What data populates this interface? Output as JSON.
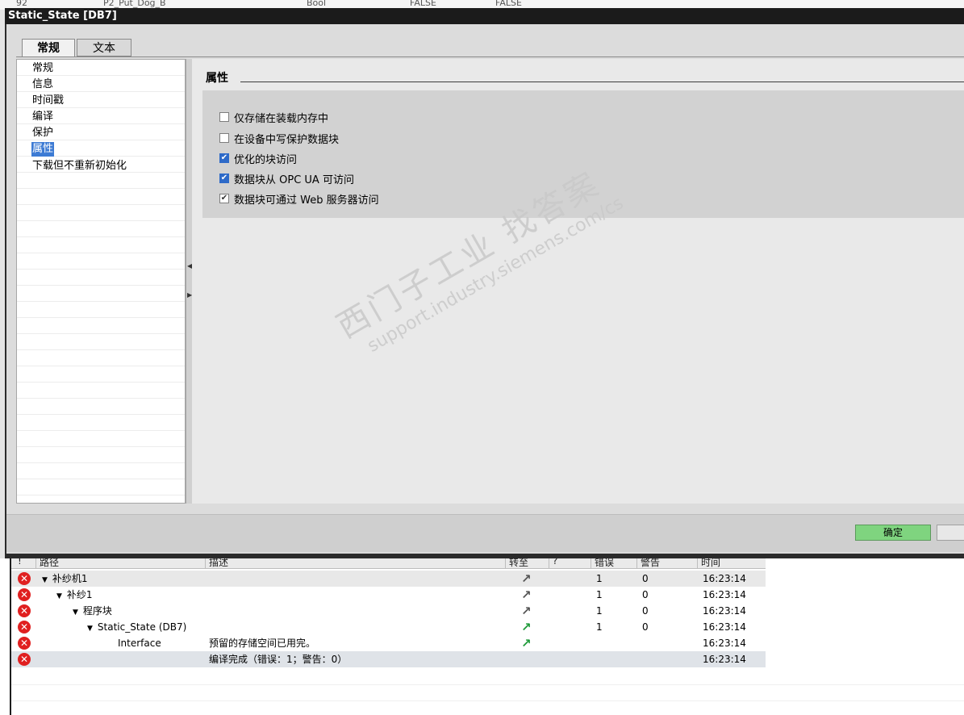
{
  "background": {
    "row_fragments": [
      "92",
      "P2_Put_Dog_B",
      "Bool",
      "FALSE",
      "FALSE"
    ]
  },
  "dialog": {
    "title": "Static_State [DB7]",
    "tabs": [
      {
        "label": "常规",
        "active": true
      },
      {
        "label": "文本",
        "active": false
      }
    ],
    "nav_items": [
      {
        "label": "常规",
        "selected": false
      },
      {
        "label": "信息",
        "selected": false
      },
      {
        "label": "时间戳",
        "selected": false
      },
      {
        "label": "编译",
        "selected": false
      },
      {
        "label": "保护",
        "selected": false
      },
      {
        "label": "属性",
        "selected": true
      },
      {
        "label": "下载但不重新初始化",
        "selected": false
      }
    ],
    "section_title": "属性",
    "properties": [
      {
        "label": "仅存储在装载内存中",
        "checked": false
      },
      {
        "label": "在设备中写保护数据块",
        "checked": false
      },
      {
        "label": "优化的块访问",
        "checked": true
      },
      {
        "label": "数据块从 OPC UA 可访问",
        "checked": true
      },
      {
        "label": "数据块可通过 Web 服务器访问",
        "checked": true
      }
    ],
    "watermark_line1": "西门子工业  找答案",
    "watermark_line2": "support.industry.siemens.com/cs",
    "ok_label": "确定",
    "colors": {
      "selection": "#3d7bd4",
      "ok_button": "#7fd47f",
      "checkbox_checked": "#2e6ac8"
    }
  },
  "results_table": {
    "headers": {
      "bang": "!",
      "path": "路径",
      "description": "描述",
      "goto": "转至",
      "q": "?",
      "errors": "错误",
      "warnings": "警告",
      "time": "时间"
    },
    "rows": [
      {
        "path": "补纱机1",
        "indent": 0,
        "tree": true,
        "description": "",
        "goto_color": "gray",
        "errors": "1",
        "warnings": "0",
        "time": "16:23:14"
      },
      {
        "path": "补纱1",
        "indent": 1,
        "tree": true,
        "description": "",
        "goto_color": "gray",
        "errors": "1",
        "warnings": "0",
        "time": "16:23:14"
      },
      {
        "path": "程序块",
        "indent": 2,
        "tree": true,
        "description": "",
        "goto_color": "gray",
        "errors": "1",
        "warnings": "0",
        "time": "16:23:14"
      },
      {
        "path": "Static_State (DB7)",
        "indent": 3,
        "tree": true,
        "description": "",
        "goto_color": "green",
        "errors": "1",
        "warnings": "0",
        "time": "16:23:14"
      },
      {
        "path": "Interface",
        "indent": 4,
        "tree": false,
        "description": "预留的存储空间已用完。",
        "goto_color": "green",
        "errors": "",
        "warnings": "",
        "time": "16:23:14"
      },
      {
        "path": "",
        "indent": 0,
        "tree": false,
        "description": "编译完成（错误：1；警告：0）",
        "goto_color": "none",
        "errors": "",
        "warnings": "",
        "time": "16:23:14"
      }
    ]
  }
}
